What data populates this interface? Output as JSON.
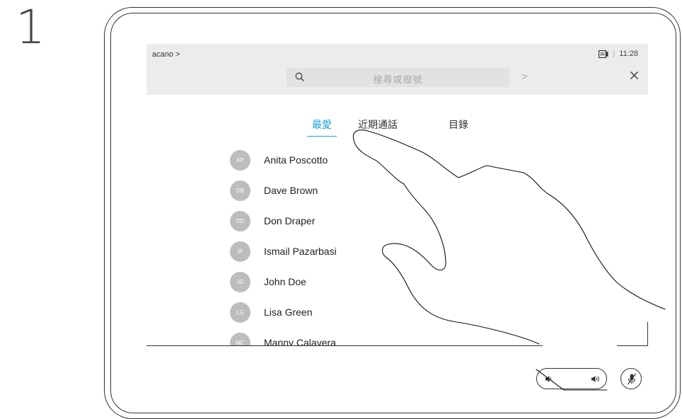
{
  "step": {
    "number": "1"
  },
  "topbar": {
    "breadcrumb": "acano >",
    "time": "11:28",
    "separator": "|"
  },
  "search": {
    "placeholder": "搜尋或撥號",
    "go_label": ">"
  },
  "tabs": [
    {
      "label": "最愛",
      "active": true
    },
    {
      "label": "近期通話",
      "active": false
    },
    {
      "label": "目錄",
      "active": false
    }
  ],
  "contacts": [
    {
      "initials": "AP",
      "name": "Anita Poscotto"
    },
    {
      "initials": "DB",
      "name": "Dave Brown"
    },
    {
      "initials": "DD",
      "name": "Don Draper"
    },
    {
      "initials": "IP",
      "name": "Ismail Pazarbasi"
    },
    {
      "initials": "JD",
      "name": "John Doe"
    },
    {
      "initials": "LG",
      "name": "Lisa Green"
    },
    {
      "initials": "MC",
      "name": "Manny Calavera"
    }
  ],
  "colors": {
    "accent": "#1ba0d7",
    "avatar": "#bdbdbd",
    "topbar": "#ececec"
  },
  "icons": {
    "camera": "camera-icon",
    "search": "search-icon",
    "close": "close-icon",
    "volume_down": "volume-down-icon",
    "volume_up": "volume-up-icon",
    "mute": "microphone-muted-icon"
  }
}
